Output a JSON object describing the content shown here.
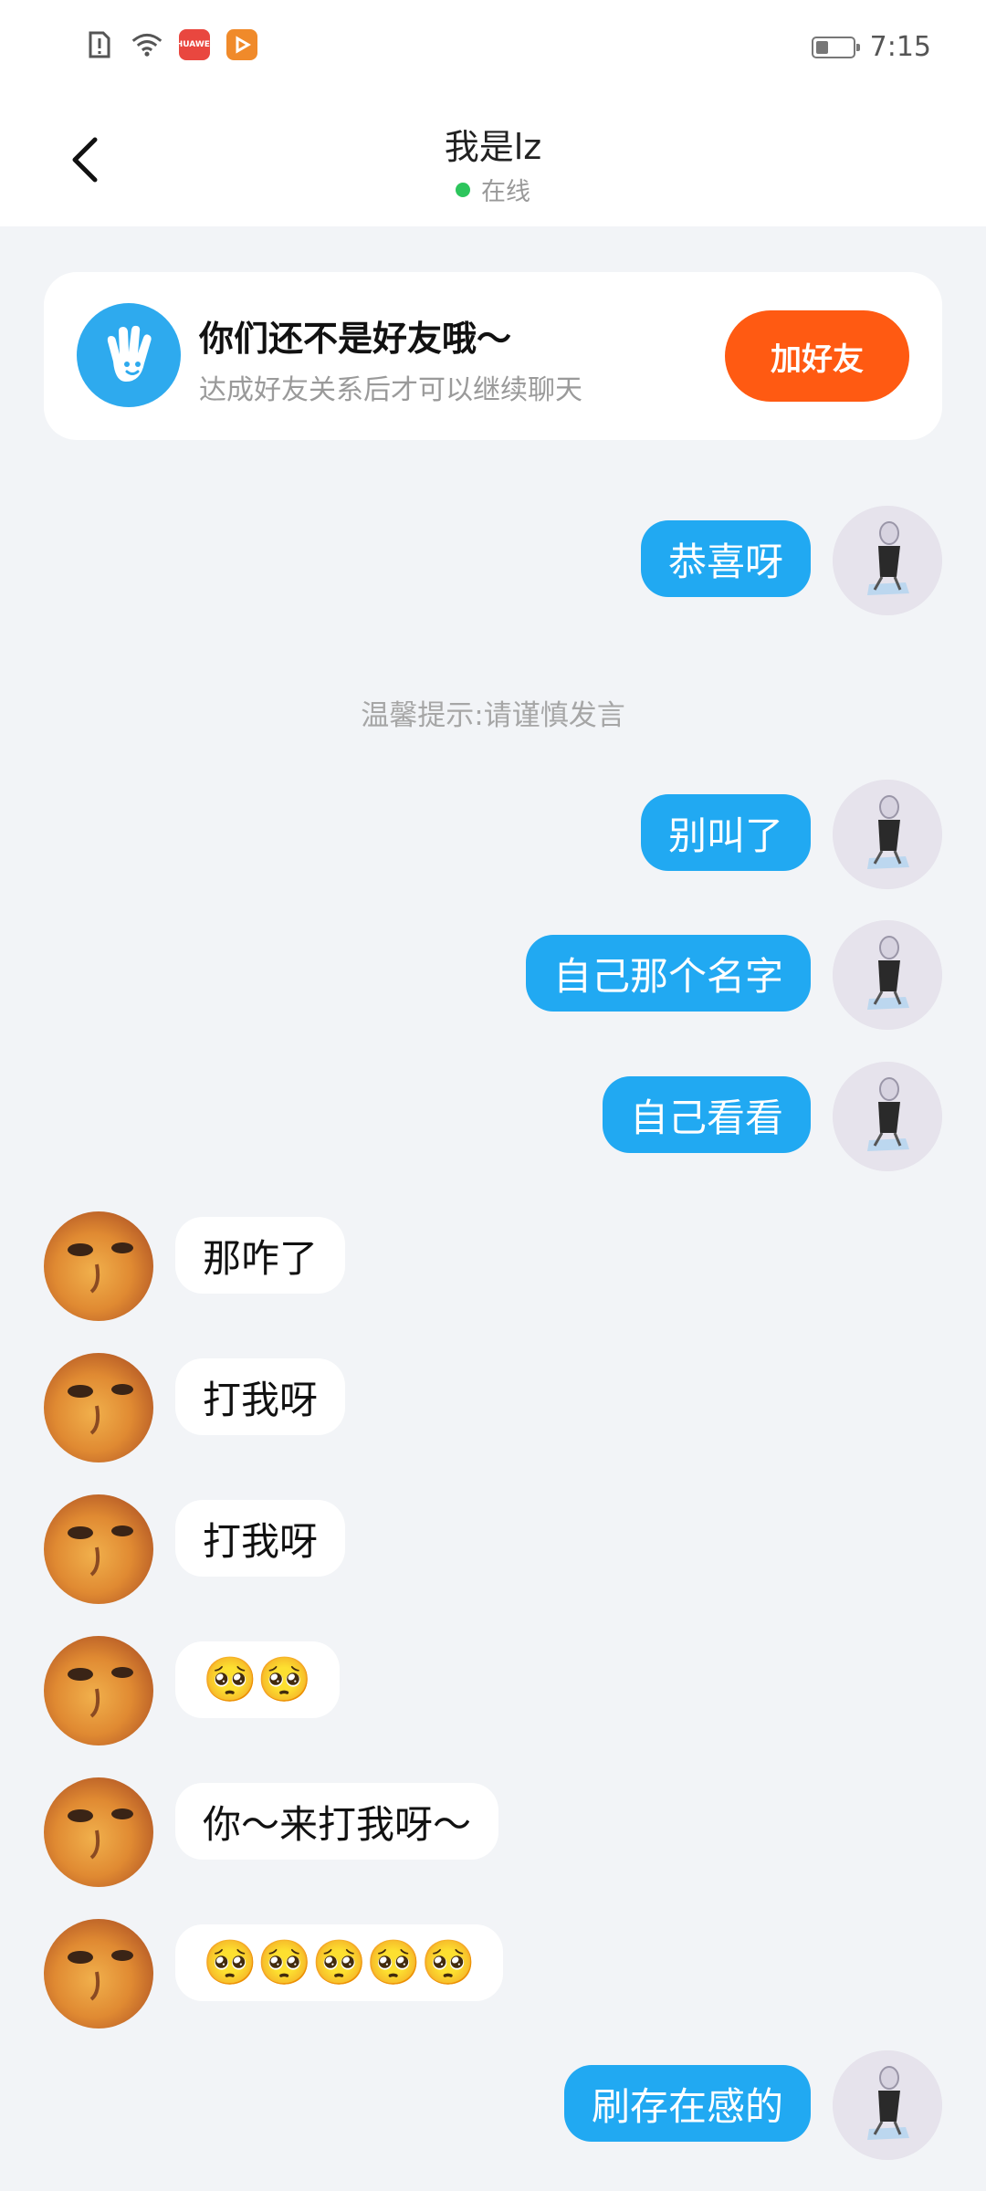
{
  "status_bar": {
    "time": "7:15",
    "icons": [
      "sim-alert-icon",
      "wifi-icon",
      "huawei-app-icon",
      "video-app-icon"
    ],
    "huawei_badge": "HUAWEI",
    "battery_level": 0.35
  },
  "header": {
    "title": "我是lz",
    "status": "在线"
  },
  "friend_card": {
    "title": "你们还不是好友哦～",
    "subtitle": "达成好友关系后才可以继续聊天",
    "button": "加好友"
  },
  "tip": "温馨提示:请谨慎发言",
  "messages": [
    {
      "dir": "out",
      "text": "恭喜呀"
    },
    {
      "dir": "out",
      "text": "别叫了"
    },
    {
      "dir": "out",
      "text": "自己那个名字"
    },
    {
      "dir": "out",
      "text": "自己看看"
    },
    {
      "dir": "in",
      "text": "那咋了"
    },
    {
      "dir": "in",
      "text": "打我呀"
    },
    {
      "dir": "in",
      "text": "打我呀"
    },
    {
      "dir": "in",
      "text": "🥺🥺"
    },
    {
      "dir": "in",
      "text": "你～来打我呀～"
    },
    {
      "dir": "in",
      "text": "🥺🥺🥺🥺🥺"
    },
    {
      "dir": "out",
      "text": "刷存在感的"
    }
  ],
  "colors": {
    "accent_blue": "#21a9f2",
    "add_button": "#ff5a12",
    "online_dot": "#2cc55c",
    "background": "#f2f4f7"
  }
}
